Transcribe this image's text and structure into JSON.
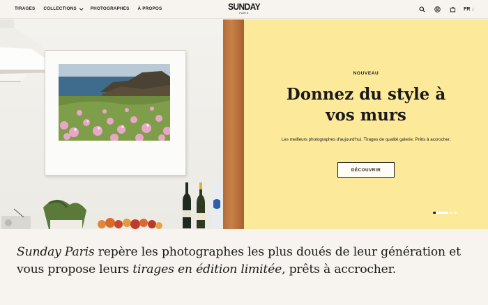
{
  "header": {
    "nav": [
      {
        "label": "TIRAGES"
      },
      {
        "label": "COLLECTIONS",
        "has_dropdown": true
      },
      {
        "label": "PHOTOGRAPHES"
      },
      {
        "label": "À PROPOS"
      }
    ],
    "logo": {
      "main": "SUNDAY",
      "sub": "PARIS"
    },
    "language": {
      "label": "FR",
      "arrow": "↓"
    },
    "icons": [
      "search-icon",
      "account-icon",
      "bag-icon"
    ]
  },
  "hero": {
    "eyebrow": "NOUVEAU",
    "headline_line1": "Donnez du style à",
    "headline_line2": "vos murs",
    "subtitle": "Les meilleurs photographes d'aujourd'hui. Tirages de qualité galerie. Prêts à accrocher.",
    "cta_label": "DÉCOUVRIR",
    "slides_count": 3,
    "active_slide": 1,
    "colors": {
      "promo_bg": "#fde99a",
      "page_bg": "#f7f4ef"
    }
  },
  "intro": {
    "part1": "Sunday Paris",
    "part2": " repère les photographes les plus doués de leur génération et vous propose leurs ",
    "part3": "tirages en édition limitée",
    "part4": ", prêts à accrocher."
  }
}
